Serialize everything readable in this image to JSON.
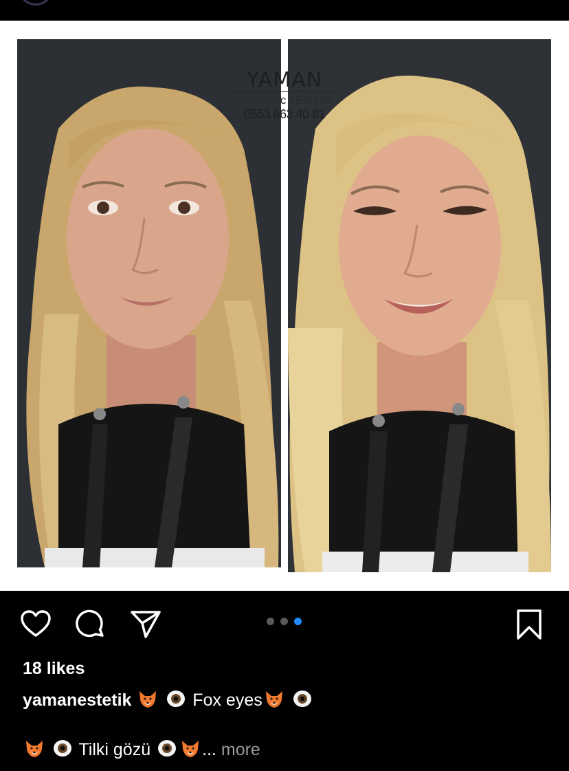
{
  "watermark": {
    "brand": "YAMAN",
    "subtitle": "Aesthetic / Estetik",
    "phone": "0553 663 40 81"
  },
  "carousel": {
    "count": 3,
    "active_index": 2,
    "accent": "#1f8bff"
  },
  "post": {
    "likes": "18 likes",
    "username": "yamanestetik",
    "caption_line1_text": "Fox eyes",
    "caption_line2_text": "Tilki gözü",
    "more_label": "more",
    "ellipsis": "..."
  },
  "icons": [
    "heart-icon",
    "comment-icon",
    "share-icon",
    "bookmark-icon",
    "fox-emoji",
    "eye-emoji"
  ],
  "colors": {
    "background": "#000000",
    "media_bg": "#ffffff",
    "muted": "#9a9a9a"
  }
}
